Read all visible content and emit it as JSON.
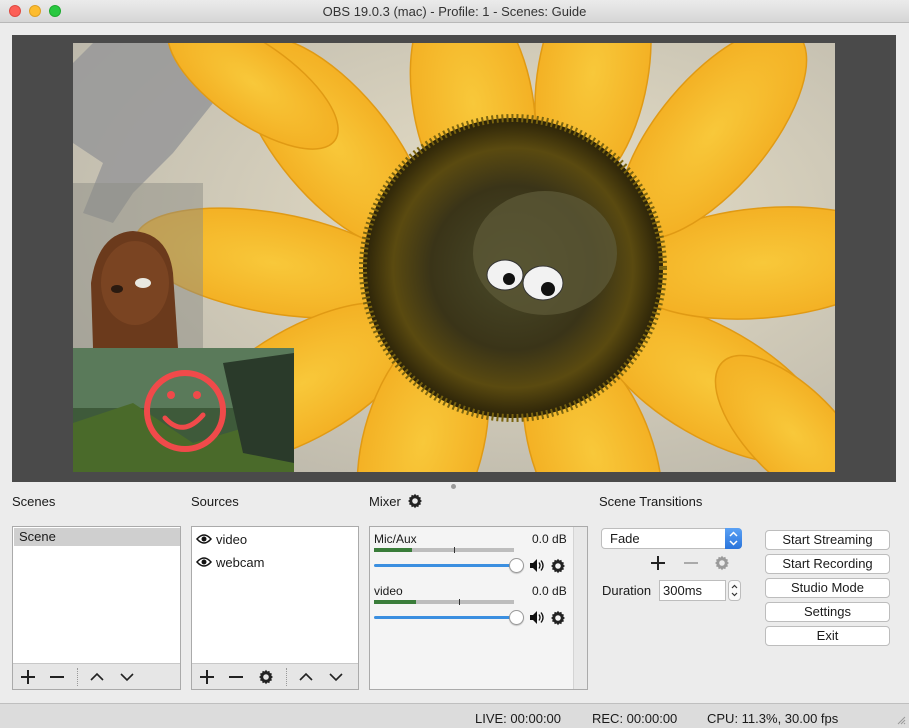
{
  "window": {
    "title": "OBS 19.0.3 (mac) - Profile: 1 - Scenes: Guide"
  },
  "scenes": {
    "label": "Scenes",
    "items": [
      "Scene"
    ]
  },
  "sources": {
    "label": "Sources",
    "items": [
      "video",
      "webcam"
    ]
  },
  "mixer": {
    "label": "Mixer",
    "channels": [
      {
        "name": "Mic/Aux",
        "level": "0.0 dB",
        "meter": 0.27,
        "volume": 1.0
      },
      {
        "name": "video",
        "level": "0.0 dB",
        "meter": 0.3,
        "volume": 1.0
      }
    ]
  },
  "transitions": {
    "label": "Scene Transitions",
    "selected": "Fade",
    "duration_label": "Duration",
    "duration_value": "300ms"
  },
  "controls": {
    "start_streaming": "Start Streaming",
    "start_recording": "Start Recording",
    "studio_mode": "Studio Mode",
    "settings": "Settings",
    "exit": "Exit"
  },
  "status": {
    "live": "LIVE: 00:00:00",
    "rec": "REC: 00:00:00",
    "cpu": "CPU: 11.3%, 30.00 fps"
  },
  "colors": {
    "accent": "#3b8fe0",
    "meter": "#3a7d3a",
    "smiley": "#f04a4a"
  }
}
